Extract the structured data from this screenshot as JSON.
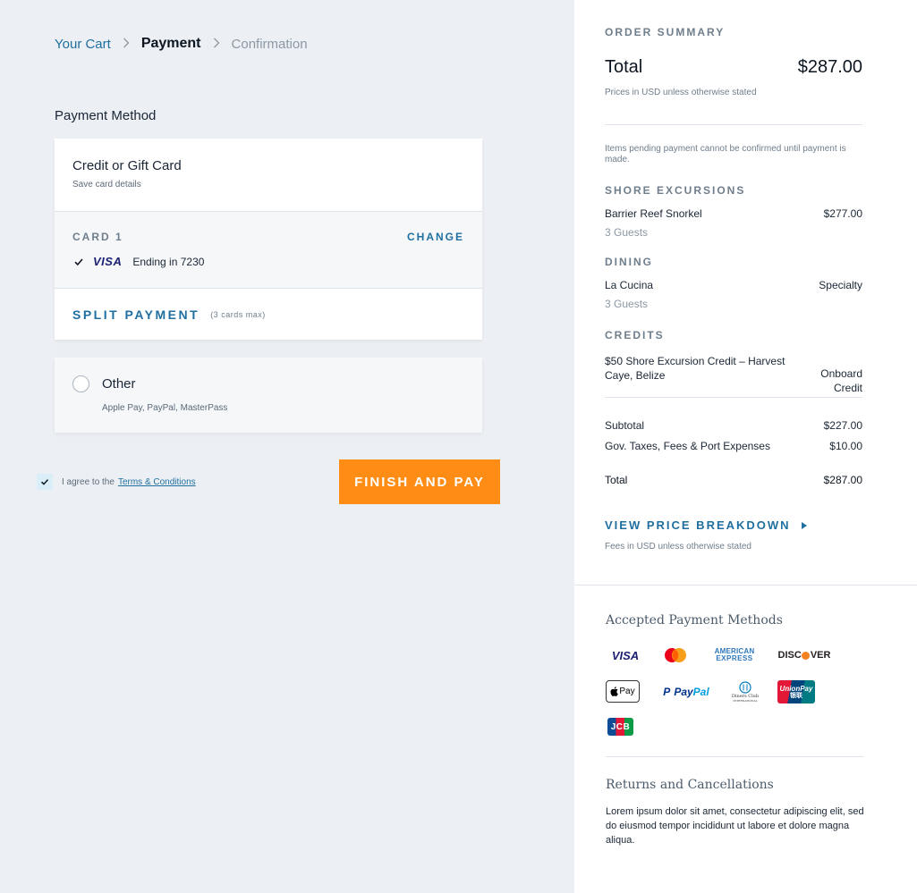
{
  "breadcrumb": {
    "cart": "Your Cart",
    "current": "Payment",
    "next": "Confirmation"
  },
  "payment_method": {
    "title": "Payment Method",
    "credit": {
      "title": "Credit or Gift Card",
      "subtitle": "Save card details"
    },
    "card1": {
      "label": "CARD 1",
      "change": "CHANGE",
      "brand": "VISA",
      "ending": "Ending in 7230"
    },
    "split": {
      "label": "SPLIT PAYMENT",
      "note": "(3 cards max)"
    },
    "other": {
      "title": "Other",
      "subtitle": "Apple Pay, PayPal, MasterPass"
    }
  },
  "agree": {
    "text": "I agree to the",
    "link": "Terms & Conditions",
    "checked": true
  },
  "finish_button": "FINISH AND PAY",
  "order_summary": {
    "title": "ORDER SUMMARY",
    "total_label": "Total",
    "total_value": "$287.00",
    "usd_note": "Prices in USD unless otherwise stated",
    "pending_note": "Items pending payment cannot be confirmed until payment is made.",
    "shore": {
      "heading": "SHORE EXCURSIONS",
      "name": "Barrier Reef Snorkel",
      "value": "$277.00",
      "guests": "3 Guests"
    },
    "dining": {
      "heading": "DINING",
      "name": "La Cucina",
      "value": "Specialty",
      "guests": "3 Guests"
    },
    "credits": {
      "heading": "CREDITS",
      "name": "$50 Shore Excursion Credit – Harvest Caye, Belize",
      "value": "Onboard Credit"
    },
    "subtotal_label": "Subtotal",
    "subtotal_value": "$227.00",
    "taxes_label": "Gov. Taxes, Fees & Port Expenses",
    "taxes_value": "$10.00",
    "final_total_label": "Total",
    "final_total_value": "$287.00",
    "price_breakdown": "VIEW PRICE BREAKDOWN",
    "fees_note": "Fees in USD unless otherwise stated"
  },
  "accepted": {
    "title": "Accepted Payment Methods",
    "logos": {
      "visa": "VISA",
      "amex_1": "AMERICAN",
      "amex_2": "EXPRESS",
      "discover": "DISC",
      "discover_2": "VER",
      "applepay": "Pay",
      "paypal_1": "Pay",
      "paypal_2": "Pal",
      "diners_1": "Diners Club",
      "diners_2": "INTERNATIONAL",
      "unionpay": "UnionPay",
      "unionpay_2": "银联",
      "jcb": "JCB"
    }
  },
  "returns": {
    "title": "Returns and Cancellations",
    "body": "Lorem ipsum dolor sit amet, consectetur adipiscing elit, sed do eiusmod tempor incididunt ut labore et dolore magna aliqua."
  }
}
